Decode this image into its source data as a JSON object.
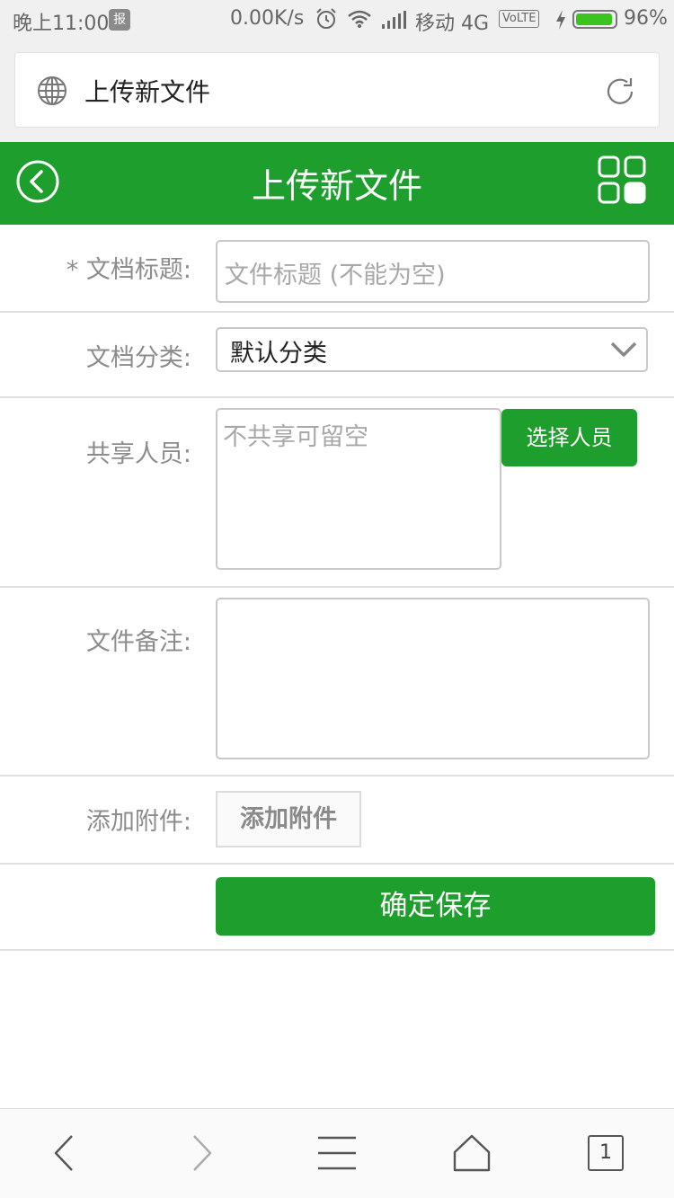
{
  "status_bar": {
    "time": "晚上11:00",
    "app_icon": "报",
    "speed": "0.00K/s",
    "carrier": "移动 4G",
    "volte": "VoLTE",
    "battery_pct": "96%",
    "battery_level": 0.96,
    "battery_color": "#3bc420"
  },
  "address_bar": {
    "title": "上传新文件"
  },
  "header": {
    "title": "上传新文件",
    "accent": "#1e9e2c"
  },
  "form": {
    "title_label": "* 文档标题:",
    "title_placeholder": "文件标题 (不能为空)",
    "category_label": "文档分类:",
    "category_value": "默认分类",
    "share_label": "共享人员:",
    "share_placeholder": "不共享可留空",
    "select_people_button": "选择人员",
    "note_label": "文件备注:",
    "attach_label": "添加附件:",
    "attach_button": "添加附件",
    "save_button": "确定保存"
  },
  "bottom_nav": {
    "icons": [
      "back-arrow-icon",
      "forward-arrow-icon",
      "menu-icon",
      "home-icon",
      "tabs-icon"
    ],
    "tab_count": "1"
  }
}
